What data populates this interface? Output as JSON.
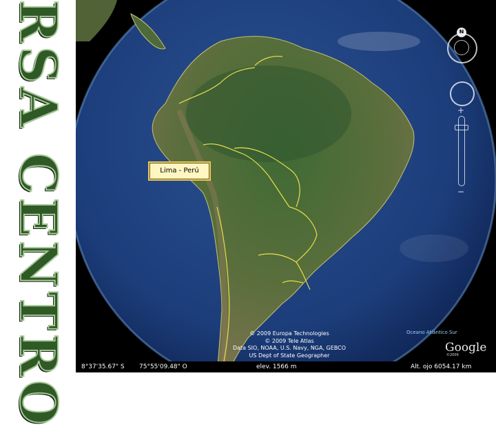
{
  "side_title": "IIRSA CENTRO",
  "placemark": {
    "label": "Lima - Perú"
  },
  "navigation": {
    "north_label": "N",
    "zoom_in": "+",
    "zoom_out": "−"
  },
  "credits": [
    "© 2009 Europa Technologies",
    "© 2009 Tele Atlas",
    "Data SIO, NOAA, U.S. Navy, NGA, GEBCO",
    "US Dept of State Geographer"
  ],
  "ocean_label": "Oceano Atlántico Sur",
  "logo": {
    "text": "Google",
    "year": "©2009"
  },
  "status_bar": {
    "latitude": "8°37'35.67\" S",
    "longitude": "75°55'09.48\" O",
    "elevation": "elev. 1566 m",
    "eye_altitude": "Alt. ojo  6054.17 km"
  },
  "colors": {
    "ocean": "#1c3d7a",
    "land": "#4c6a38",
    "border": "#e8e04a",
    "title": "#2f5a26"
  }
}
